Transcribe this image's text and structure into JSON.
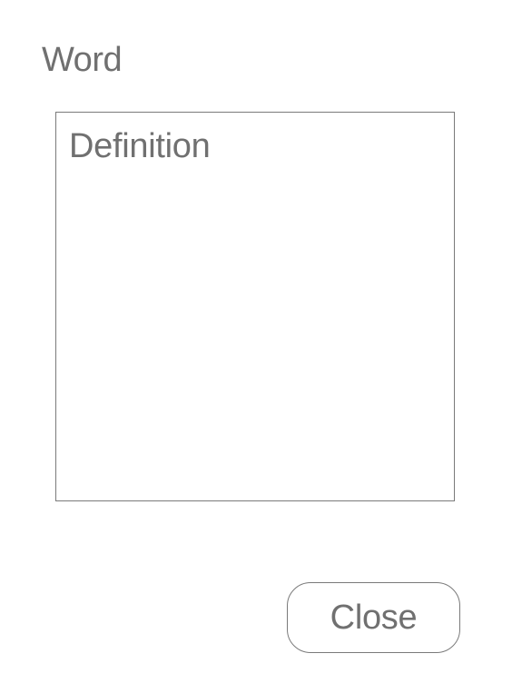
{
  "header": {
    "title": "Word"
  },
  "main": {
    "definition_text": "Definition"
  },
  "footer": {
    "close_label": "Close"
  },
  "colors": {
    "text": "#707070",
    "border": "#7a7a7a",
    "background": "#ffffff"
  }
}
